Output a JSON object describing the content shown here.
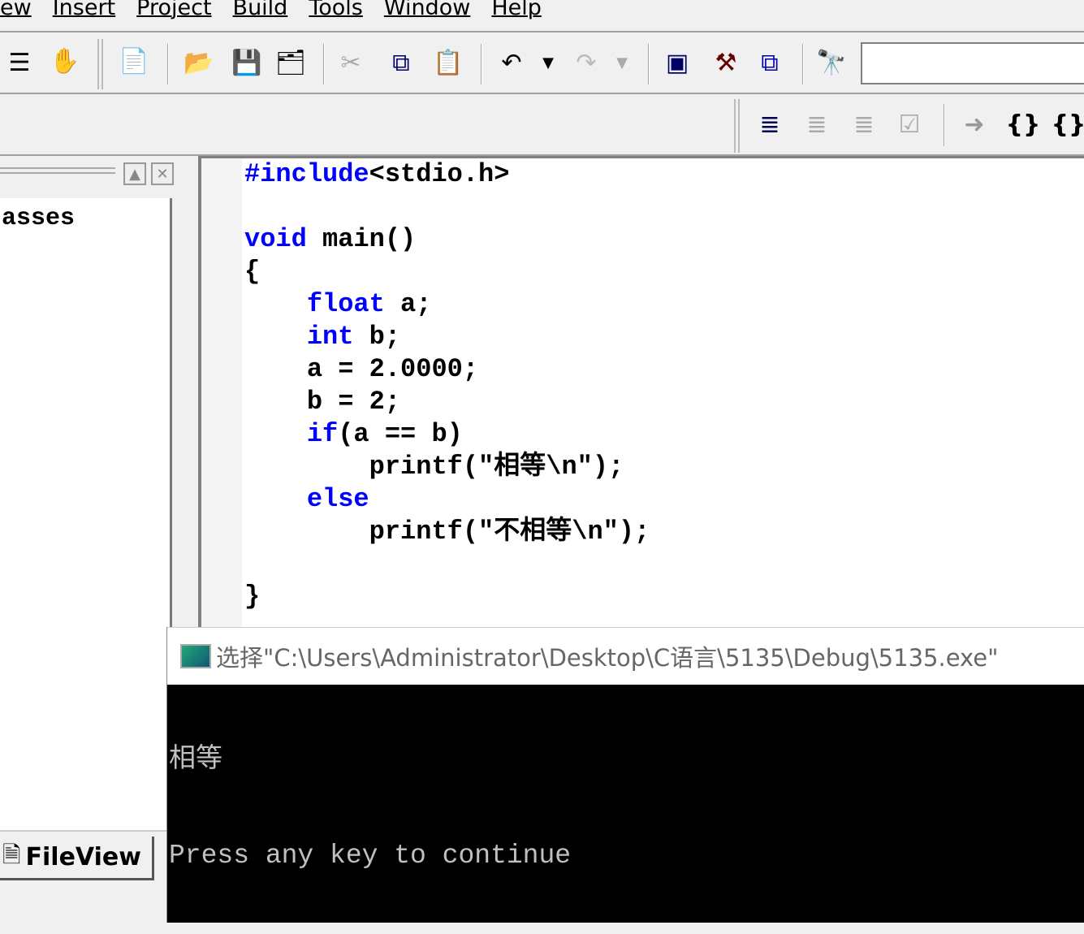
{
  "menubar": {
    "items": [
      "ew",
      "Insert",
      "Project",
      "Build",
      "Tools",
      "Window",
      "Help"
    ]
  },
  "toolbar": {
    "icons": [
      "sort-icon",
      "hand-icon",
      "new-text-file-icon",
      "open-folder-icon",
      "save-icon",
      "save-all-icon",
      "cut-icon",
      "copy-icon",
      "paste-icon",
      "undo-icon",
      "redo-icon",
      "workspace-icon",
      "output-icon",
      "window-list-icon",
      "find-in-files-icon"
    ],
    "find_value": ""
  },
  "toolbar2": {
    "icons": [
      "debug-run-icon",
      "stop-debug-icon",
      "break-icon",
      "apply-code-changes-icon",
      "show-next-statement-icon",
      "step-into-icon",
      "step-over-icon"
    ]
  },
  "left_pane": {
    "list_text": "asses",
    "tab_label": "FileView"
  },
  "editor": {
    "keyword_color": "#0000ff",
    "lines": [
      [
        {
          "t": "#include",
          "k": true
        },
        {
          "t": "<stdio.h>"
        }
      ],
      [],
      [
        {
          "t": "void",
          "k": true
        },
        {
          "t": " main()"
        }
      ],
      [
        {
          "t": "{"
        }
      ],
      [
        {
          "t": "    "
        },
        {
          "t": "float",
          "k": true
        },
        {
          "t": " a;"
        }
      ],
      [
        {
          "t": "    "
        },
        {
          "t": "int",
          "k": true
        },
        {
          "t": " b;"
        }
      ],
      [
        {
          "t": "    a = 2.0000;"
        }
      ],
      [
        {
          "t": "    b = 2;"
        }
      ],
      [
        {
          "t": "    "
        },
        {
          "t": "if",
          "k": true
        },
        {
          "t": "(a == b)"
        }
      ],
      [
        {
          "t": "        printf(\"相等\\n\");"
        }
      ],
      [
        {
          "t": "    "
        },
        {
          "t": "else",
          "k": true
        }
      ],
      [
        {
          "t": "        printf(\"不相等\\n\");"
        }
      ],
      [],
      [
        {
          "t": "}"
        }
      ]
    ]
  },
  "console": {
    "title": "选择\"C:\\Users\\Administrator\\Desktop\\C语言\\5135\\Debug\\5135.exe\"",
    "lines": [
      "相等",
      "Press any key to continue"
    ]
  }
}
